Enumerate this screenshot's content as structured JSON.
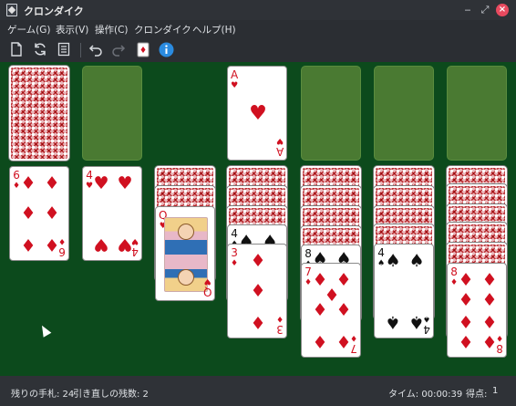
{
  "window": {
    "title": "クロンダイク",
    "close_icon": "close-icon"
  },
  "menu": [
    "ゲーム(G)",
    "表示(V)",
    "操作(C)",
    "クロンダイク",
    "ヘルプ(H)"
  ],
  "toolbar": {
    "icons": [
      "new-game-icon",
      "restart-icon",
      "statistics-icon",
      "undo-icon",
      "redo-icon",
      "hint-icon",
      "info-icon"
    ]
  },
  "cards": {
    "foundation_1": {
      "rank": "A",
      "suit": "♥",
      "color": "red"
    },
    "col1": {
      "rank": "6",
      "suit": "♦",
      "color": "red"
    },
    "col2": {
      "rank": "4",
      "suit": "♥",
      "color": "red"
    },
    "col3": {
      "rank": "Q",
      "suit": "♥",
      "color": "red"
    },
    "col4_a": {
      "rank": "4",
      "suit": "♠",
      "color": "black"
    },
    "col4_b": {
      "rank": "3",
      "suit": "♦",
      "color": "red"
    },
    "col5_a": {
      "rank": "8",
      "suit": "♠",
      "color": "black"
    },
    "col5_b": {
      "rank": "7",
      "suit": "♦",
      "color": "red"
    },
    "col6": {
      "rank": "4",
      "suit": "♠",
      "color": "black"
    },
    "col7": {
      "rank": "8",
      "suit": "♦",
      "color": "red"
    }
  },
  "status": {
    "remaining": "残りの手札: 24",
    "redeals": "引き直しの残数: 2",
    "time": "タイム: 00:00:39",
    "score_label": "得点:",
    "score_value": "1"
  },
  "colors": {
    "table": "#0c4a1c",
    "slot": "#4a7a32",
    "red_suit": "#d01020",
    "chrome": "#2b2e33"
  }
}
